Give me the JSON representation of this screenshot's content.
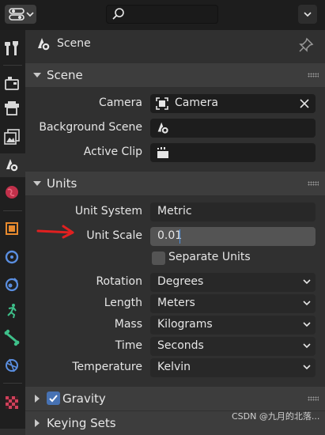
{
  "header": {
    "editor_icon": "properties-editor-icon",
    "search_placeholder": "",
    "menu_icon": "chevron-down-icon"
  },
  "tabs": [
    {
      "name": "tool",
      "icon": "wrench-screwdriver-icon"
    },
    {
      "name": "render",
      "icon": "camera-back-icon"
    },
    {
      "name": "output",
      "icon": "printer-icon"
    },
    {
      "name": "view-layer",
      "icon": "image-stack-icon"
    },
    {
      "name": "scene",
      "icon": "scene-cone-sphere-icon",
      "active": true
    },
    {
      "name": "world",
      "icon": "globe-icon"
    },
    {
      "name": "object",
      "icon": "orange-square-icon"
    },
    {
      "name": "modifiers",
      "icon": "blue-wrench-icon"
    },
    {
      "name": "particles",
      "icon": "particles-icon"
    },
    {
      "name": "physics",
      "icon": "orbit-icon"
    },
    {
      "name": "constraints",
      "icon": "running-figure-icon"
    },
    {
      "name": "data",
      "icon": "bone-icon"
    },
    {
      "name": "object-data",
      "icon": "camera-data-icon"
    },
    {
      "name": "texture",
      "icon": "checkerboard-icon"
    }
  ],
  "context": {
    "title": "Scene"
  },
  "scene_panel": {
    "title": "Scene",
    "camera_label": "Camera",
    "camera_value": "Camera",
    "background_label": "Background Scene",
    "background_value": "",
    "clip_label": "Active Clip",
    "clip_value": ""
  },
  "units_panel": {
    "title": "Units",
    "unit_system_label": "Unit System",
    "unit_system_value": "Metric",
    "unit_scale_label": "Unit Scale",
    "unit_scale_value": "0.01",
    "separate_units_label": "Separate Units",
    "separate_units_checked": false,
    "rotation_label": "Rotation",
    "rotation_value": "Degrees",
    "length_label": "Length",
    "length_value": "Meters",
    "mass_label": "Mass",
    "mass_value": "Kilograms",
    "time_label": "Time",
    "time_value": "Seconds",
    "temperature_label": "Temperature",
    "temperature_value": "Kelvin"
  },
  "gravity_panel": {
    "title": "Gravity",
    "checked": true
  },
  "keying_panel": {
    "title": "Keying Sets"
  },
  "watermark": "CSDN @九月的北落...",
  "colors": {
    "background": "#303030",
    "panel_header": "#3d3d3d",
    "field": "#1d1d1d",
    "number_field": "#545454",
    "accent": "#4772b3",
    "annotation_arrow": "#e02020"
  }
}
